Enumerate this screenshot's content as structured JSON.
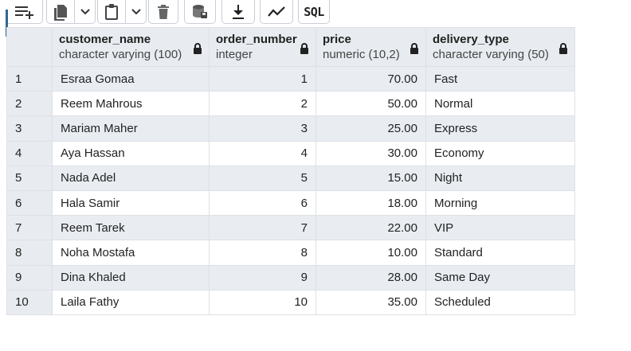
{
  "toolbar": {
    "buttons": [
      {
        "name": "add-row",
        "icon": "add-row-icon"
      },
      {
        "name": "copy",
        "icon": "copy-icon"
      },
      {
        "name": "paste",
        "icon": "paste-icon"
      },
      {
        "name": "delete",
        "icon": "trash-icon"
      },
      {
        "name": "save-data",
        "icon": "save-data-icon"
      },
      {
        "name": "download",
        "icon": "download-icon"
      },
      {
        "name": "graph",
        "icon": "graph-icon"
      }
    ],
    "sql_label": "SQL"
  },
  "grid": {
    "columns": [
      {
        "name": "customer_name",
        "type": "character varying (100)",
        "align": "left"
      },
      {
        "name": "order_number",
        "type": "integer",
        "align": "right"
      },
      {
        "name": "price",
        "type": "numeric (10,2)",
        "align": "right"
      },
      {
        "name": "delivery_type",
        "type": "character varying (50)",
        "align": "left"
      }
    ],
    "rows": [
      {
        "row": "1",
        "cells": [
          "Esraa Gomaa",
          "1",
          "70.00",
          "Fast"
        ]
      },
      {
        "row": "2",
        "cells": [
          "Reem Mahrous",
          "2",
          "50.00",
          "Normal"
        ]
      },
      {
        "row": "3",
        "cells": [
          "Mariam Maher",
          "3",
          "25.00",
          "Express"
        ]
      },
      {
        "row": "4",
        "cells": [
          "Aya Hassan",
          "4",
          "30.00",
          "Economy"
        ]
      },
      {
        "row": "5",
        "cells": [
          "Nada Adel",
          "5",
          "15.00",
          "Night"
        ]
      },
      {
        "row": "6",
        "cells": [
          "Hala Samir",
          "6",
          "18.00",
          "Morning"
        ]
      },
      {
        "row": "7",
        "cells": [
          "Reem Tarek",
          "7",
          "22.00",
          "VIP"
        ]
      },
      {
        "row": "8",
        "cells": [
          "Noha Mostafa",
          "8",
          "10.00",
          "Standard"
        ]
      },
      {
        "row": "9",
        "cells": [
          "Dina Khaled",
          "9",
          "28.00",
          "Same Day"
        ]
      },
      {
        "row": "10",
        "cells": [
          "Laila Fathy",
          "10",
          "35.00",
          "Scheduled"
        ]
      }
    ]
  },
  "colors": {
    "header_bg": "#e8ecf0",
    "stripe_bg": "#e9edf2",
    "focus_accent": "#326690"
  }
}
